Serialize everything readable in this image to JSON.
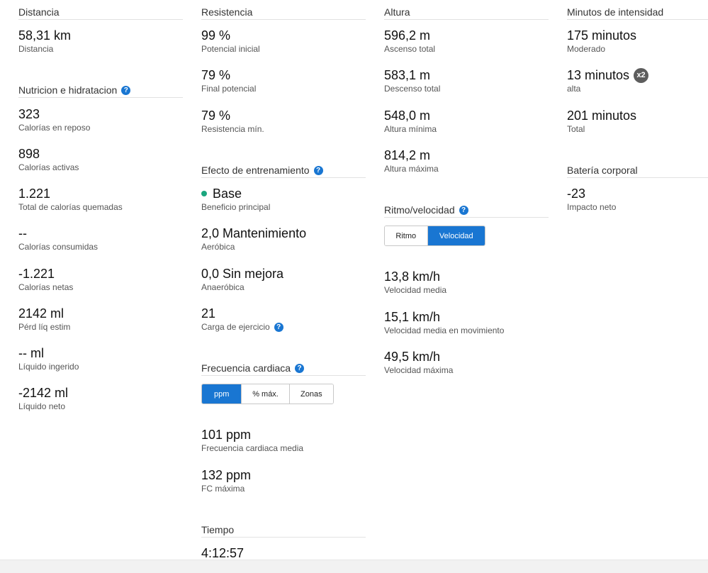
{
  "col1": {
    "distance": {
      "title": "Distancia",
      "value": "58,31 km",
      "label": "Distancia"
    },
    "nutrition": {
      "title": "Nutricion e hidratacion",
      "items": [
        {
          "value": "323",
          "label": "Calorías en reposo"
        },
        {
          "value": "898",
          "label": "Calorías activas"
        },
        {
          "value": "1.221",
          "label": "Total de calorías quemadas"
        },
        {
          "value": "--",
          "label": "Calorías consumidas"
        },
        {
          "value": "-1.221",
          "label": "Calorías netas"
        },
        {
          "value": "2142 ml",
          "label": "Pérd líq estim"
        },
        {
          "value": "-- ml",
          "label": "Líquido ingerido"
        },
        {
          "value": "-2142 ml",
          "label": "Líquido neto"
        }
      ]
    }
  },
  "col2": {
    "stamina": {
      "title": "Resistencia",
      "items": [
        {
          "value": "99 %",
          "label": "Potencial inicial"
        },
        {
          "value": "79 %",
          "label": "Final potencial"
        },
        {
          "value": "79 %",
          "label": "Resistencia mín."
        }
      ]
    },
    "training": {
      "title": "Efecto de entrenamiento",
      "items": [
        {
          "value": "Base",
          "label": "Beneficio principal"
        },
        {
          "value": "2,0 Mantenimiento",
          "label": "Aeróbica"
        },
        {
          "value": "0,0 Sin mejora",
          "label": "Anaeróbica"
        },
        {
          "value": "21",
          "label": "Carga de ejercicio"
        }
      ]
    },
    "heart": {
      "title": "Frecuencia cardiaca",
      "tabs": [
        "ppm",
        "% máx.",
        "Zonas"
      ],
      "items": [
        {
          "value": "101 ppm",
          "label": "Frecuencia cardiaca media"
        },
        {
          "value": "132 ppm",
          "label": "FC máxima"
        }
      ]
    },
    "time": {
      "title": "Tiempo",
      "value": "4:12:57"
    }
  },
  "col3": {
    "elevation": {
      "title": "Altura",
      "items": [
        {
          "value": "596,2 m",
          "label": "Ascenso total"
        },
        {
          "value": "583,1 m",
          "label": "Descenso total"
        },
        {
          "value": "548,0 m",
          "label": "Altura mínima"
        },
        {
          "value": "814,2 m",
          "label": "Altura máxima"
        }
      ]
    },
    "pace": {
      "title": "Ritmo/velocidad",
      "tabs": [
        "Ritmo",
        "Velocidad"
      ],
      "items": [
        {
          "value": "13,8 km/h",
          "label": "Velocidad media"
        },
        {
          "value": "15,1 km/h",
          "label": "Velocidad media en movimiento"
        },
        {
          "value": "49,5 km/h",
          "label": "Velocidad máxima"
        }
      ]
    }
  },
  "col4": {
    "intensity": {
      "title": "Minutos de intensidad",
      "items": [
        {
          "value": "175 minutos",
          "label": "Moderado"
        },
        {
          "value": "13 minutos",
          "label": "alta",
          "badge": "x2"
        },
        {
          "value": "201 minutos",
          "label": "Total"
        }
      ]
    },
    "battery": {
      "title": "Batería corporal",
      "value": "-23",
      "label": "Impacto neto"
    }
  },
  "help_glyph": "?",
  "accent_color": "#1976d2",
  "base_dot_color": "#1aa67e"
}
